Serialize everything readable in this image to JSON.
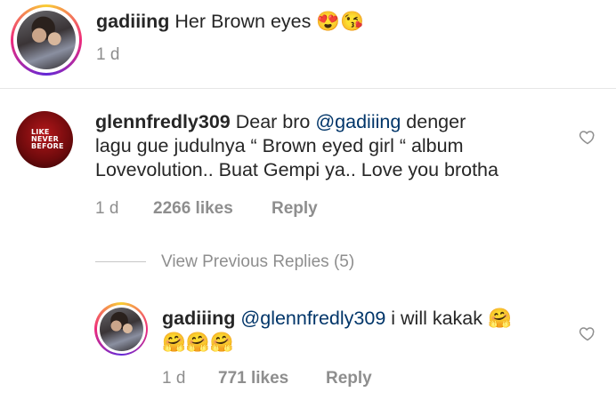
{
  "comments": [
    {
      "username": "gadiiing",
      "text": "Her Brown eyes",
      "emoji": "😍😘",
      "age": "1 d"
    },
    {
      "username": "glennfredly309",
      "avatar_text": [
        "LIKE",
        "NEVER",
        "BEFORE"
      ],
      "text_line1_a": "Dear bro ",
      "mention": "@gadiiing",
      "text_line1_b": " denger",
      "text_line2": "lagu gue judulnya “ Brown eyed girl “ album",
      "text_line3": "Lovevolution.. Buat Gempi ya.. Love you brotha",
      "age": "1 d",
      "likes": "2266 likes",
      "reply_label": "Reply"
    }
  ],
  "view_previous": "View Previous Replies (5)",
  "reply": {
    "username": "gadiiing",
    "mention": "@glennfredly309",
    "text": " i will kakak ",
    "emoji_inline": "🤗",
    "emoji_line2": "🤗🤗🤗",
    "age": "1 d",
    "likes": "771 likes",
    "reply_label": "Reply"
  },
  "icons": {
    "like": "heart-outline-icon"
  },
  "colors": {
    "text": "#262626",
    "secondary": "#8e8e8e",
    "mention": "#003569",
    "divider": "#dbdbdb"
  }
}
